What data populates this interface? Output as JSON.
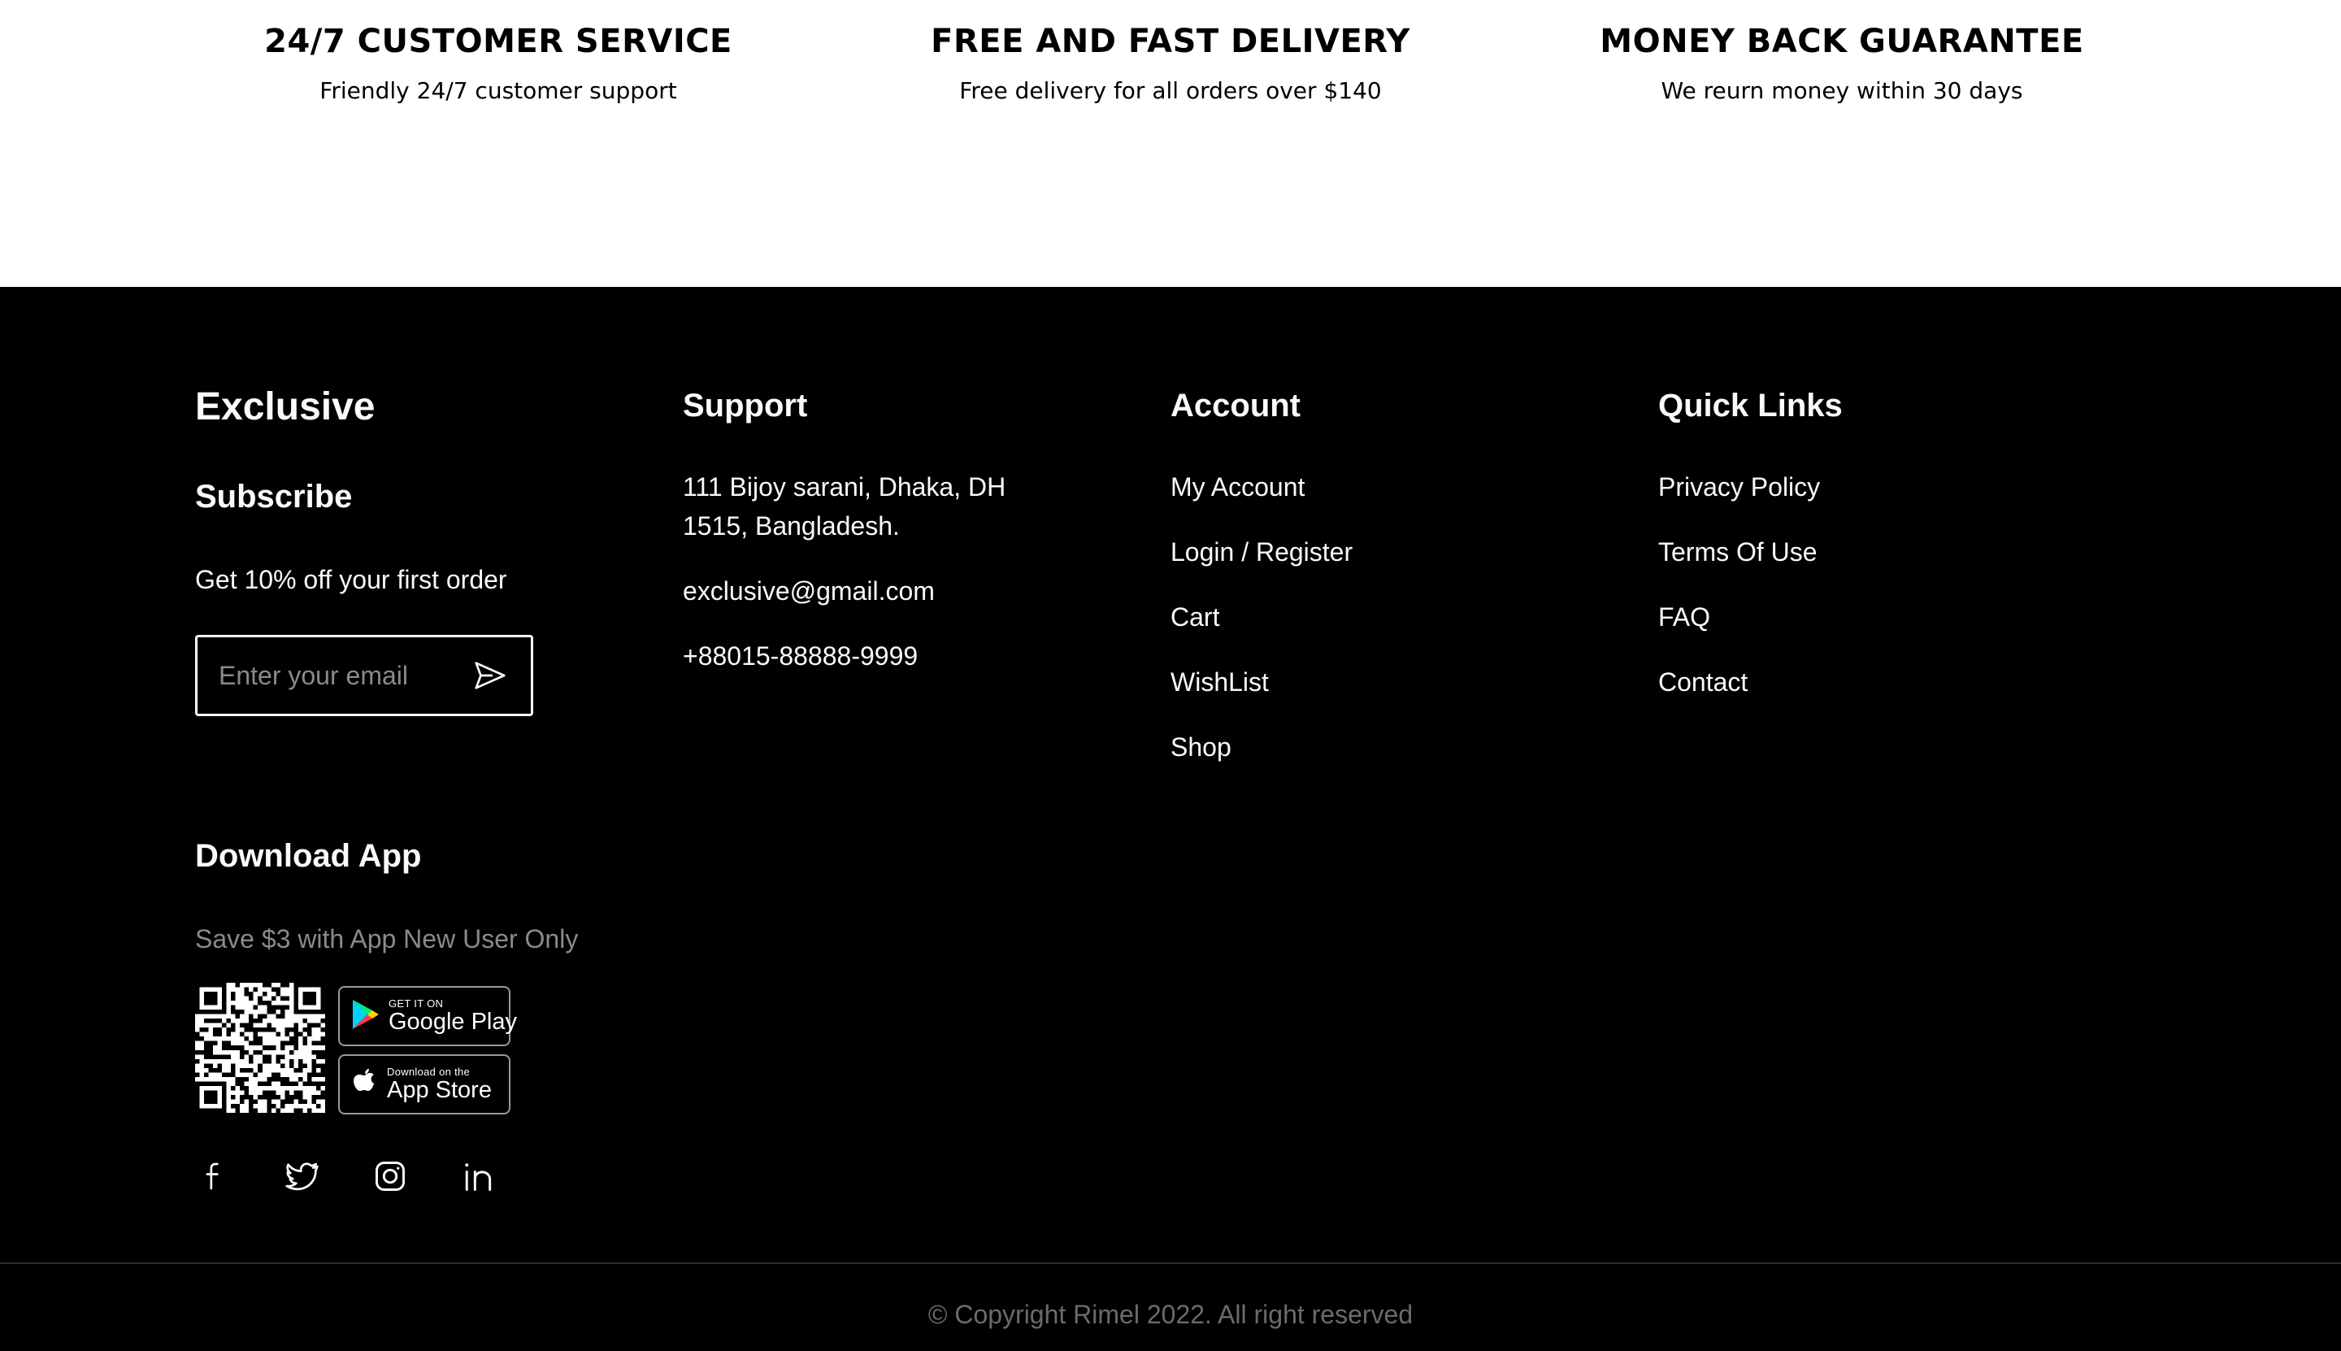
{
  "features": [
    {
      "title": "24/7 CUSTOMER SERVICE",
      "description": "Friendly 24/7 customer support"
    },
    {
      "title": "FREE AND FAST DELIVERY",
      "description": "Free delivery for all orders over $140"
    },
    {
      "title": "MONEY BACK GUARANTEE",
      "description": "We reurn money within 30 days"
    }
  ],
  "footer": {
    "brand": "Exclusive",
    "subscribe": {
      "title": "Subscribe",
      "offer": "Get 10% off your first order",
      "email_placeholder": "Enter your email",
      "send_icon": "send-icon"
    },
    "support": {
      "title": "Support",
      "address": "111 Bijoy sarani, Dhaka, DH 1515, Bangladesh.",
      "email": "exclusive@gmail.com",
      "phone": "+88015-88888-9999"
    },
    "account": {
      "title": "Account",
      "links": [
        "My Account",
        "Login / Register",
        "Cart",
        "WishList",
        "Shop"
      ]
    },
    "quick_links": {
      "title": "Quick Links",
      "links": [
        "Privacy Policy",
        "Terms Of Use",
        "FAQ",
        "Contact"
      ]
    },
    "download": {
      "title": "Download App",
      "subtitle": "Save $3 with App New User Only",
      "google_play": {
        "small": "GET IT ON",
        "big": "Google Play"
      },
      "app_store": {
        "small": "Download on the",
        "big": "App Store"
      }
    },
    "socials": [
      "facebook-icon",
      "twitter-icon",
      "instagram-icon",
      "linkedin-icon"
    ],
    "copyright": "© Copyright Rimel 2022. All right reserved",
    "colors": {
      "background": "#000000",
      "text": "#fafafa",
      "muted": "#8a8a8a",
      "copyright": "#6b6b6b",
      "divider": "#2b2b2b"
    }
  }
}
